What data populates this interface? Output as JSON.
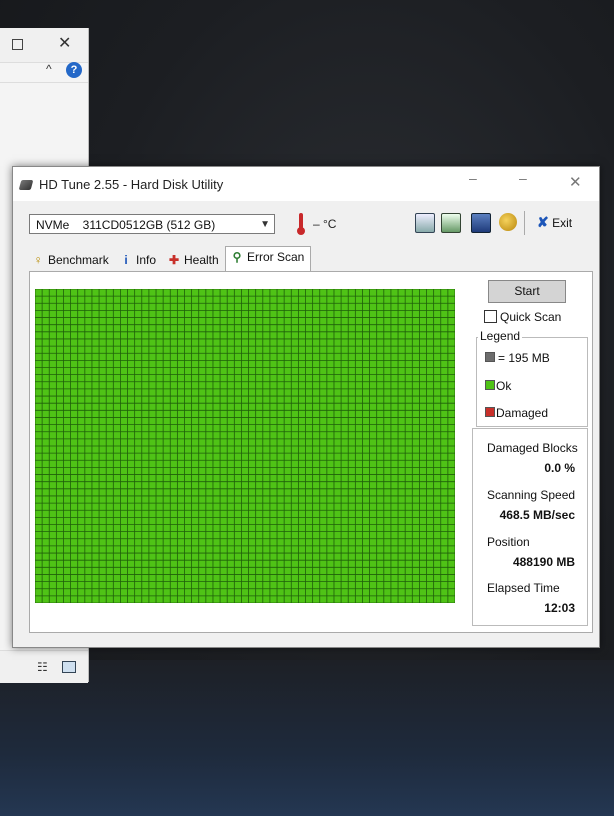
{
  "window": {
    "title": "HD Tune 2.55 - Hard Disk Utility",
    "minimize_glyph": "–",
    "restore_glyph": "–",
    "close_glyph": "✕"
  },
  "toolbar": {
    "drive_label": "NVMe    311CD0512GB (512 GB)",
    "temperature": "– °C",
    "exit_label": "Exit"
  },
  "tabs": [
    {
      "label": "Benchmark",
      "icon": "lightbulb-icon"
    },
    {
      "label": "Info",
      "icon": "info-icon"
    },
    {
      "label": "Health",
      "icon": "health-cross-icon"
    },
    {
      "label": "Error Scan",
      "icon": "magnifier-icon"
    }
  ],
  "scan": {
    "start_label": "Start",
    "quick_scan_label": "Quick Scan",
    "quick_scan_checked": false,
    "legend_title": "Legend",
    "legend_block": "= 195 MB",
    "legend_ok": "Ok",
    "legend_damaged": "Damaged",
    "ok_color": "#4fc316",
    "damaged_color": "#c8302a",
    "block_color": "#6d6d6d",
    "grid_columns": 59,
    "grid_rows": 44,
    "damaged_blocks_label": "Damaged Blocks",
    "damaged_blocks_value": "0.0 %",
    "scanning_speed_label": "Scanning Speed",
    "scanning_speed_value": "468.5 MB/sec",
    "position_label": "Position",
    "position_value": "488190 MB",
    "elapsed_label": "Elapsed Time",
    "elapsed_value": "12:03"
  }
}
